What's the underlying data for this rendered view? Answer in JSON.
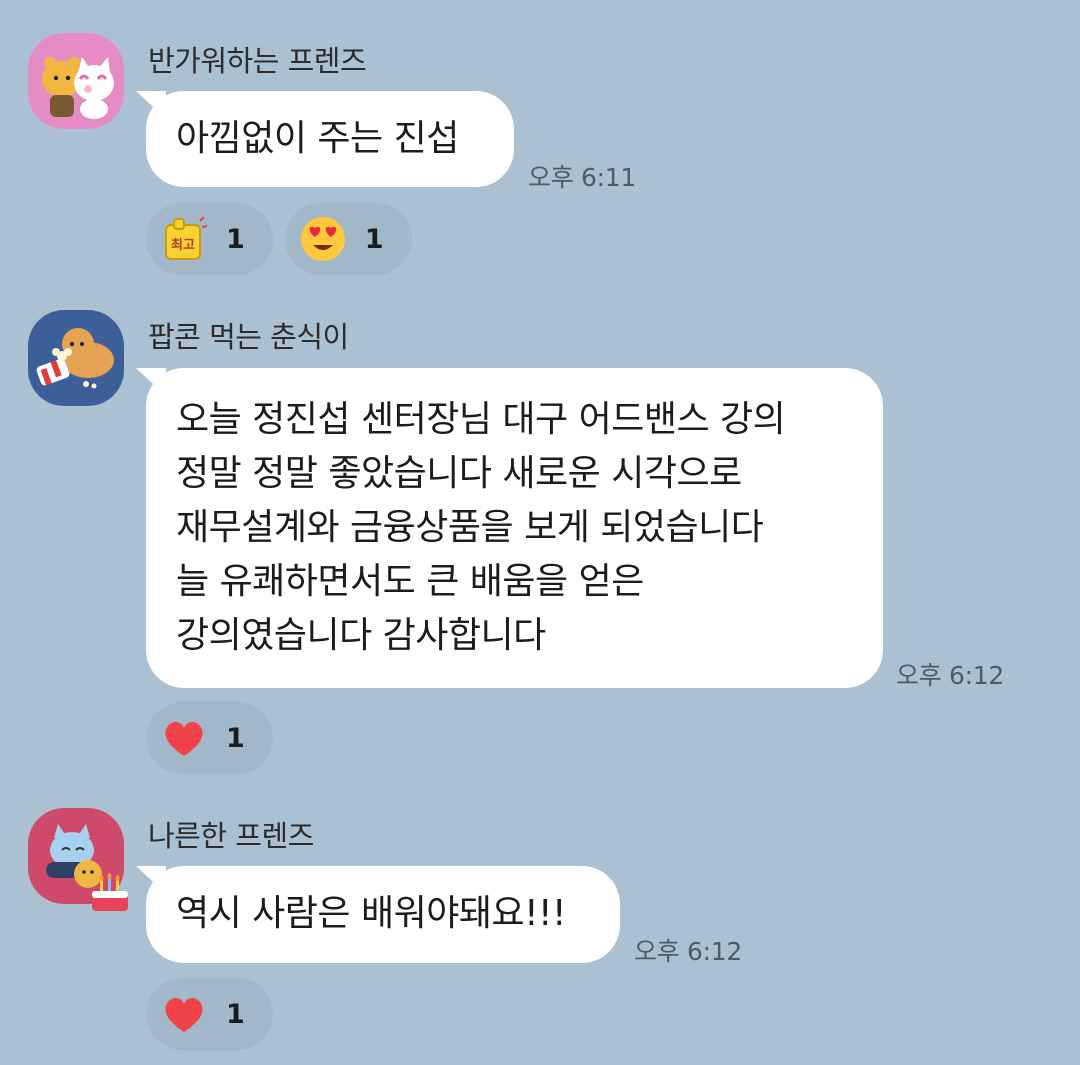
{
  "messages": [
    {
      "sender": "반가워하는 프렌즈",
      "text": "아낌없이 주는 진섭",
      "time": "오후 6:11",
      "reactions": [
        {
          "icon": "best-sticker-icon",
          "label": "최고",
          "count": "1"
        },
        {
          "icon": "heart-eyes-emoji-icon",
          "count": "1"
        }
      ]
    },
    {
      "sender": "팝콘 먹는 춘식이",
      "text": "오늘 정진섭 센터장님 대구 어드밴스 강의\n정말 정말 좋았습니다 새로운 시각으로\n재무설계와 금융상품을 보게 되었습니다\n늘 유쾌하면서도 큰 배움을 얻은\n강의였습니다 감사합니다",
      "time": "오후 6:12",
      "reactions": [
        {
          "icon": "red-heart-icon",
          "count": "1"
        }
      ]
    },
    {
      "sender": "나른한 프렌즈",
      "text": "역시 사람은 배워야돼요!!!",
      "time": "오후 6:12",
      "reactions": [
        {
          "icon": "red-heart-icon",
          "count": "1"
        }
      ]
    }
  ],
  "colors": {
    "chat_background": "#abc1d1",
    "bubble": "#ffffff",
    "reaction_pill": "#a2b8c8",
    "heart": "#f0424a"
  }
}
